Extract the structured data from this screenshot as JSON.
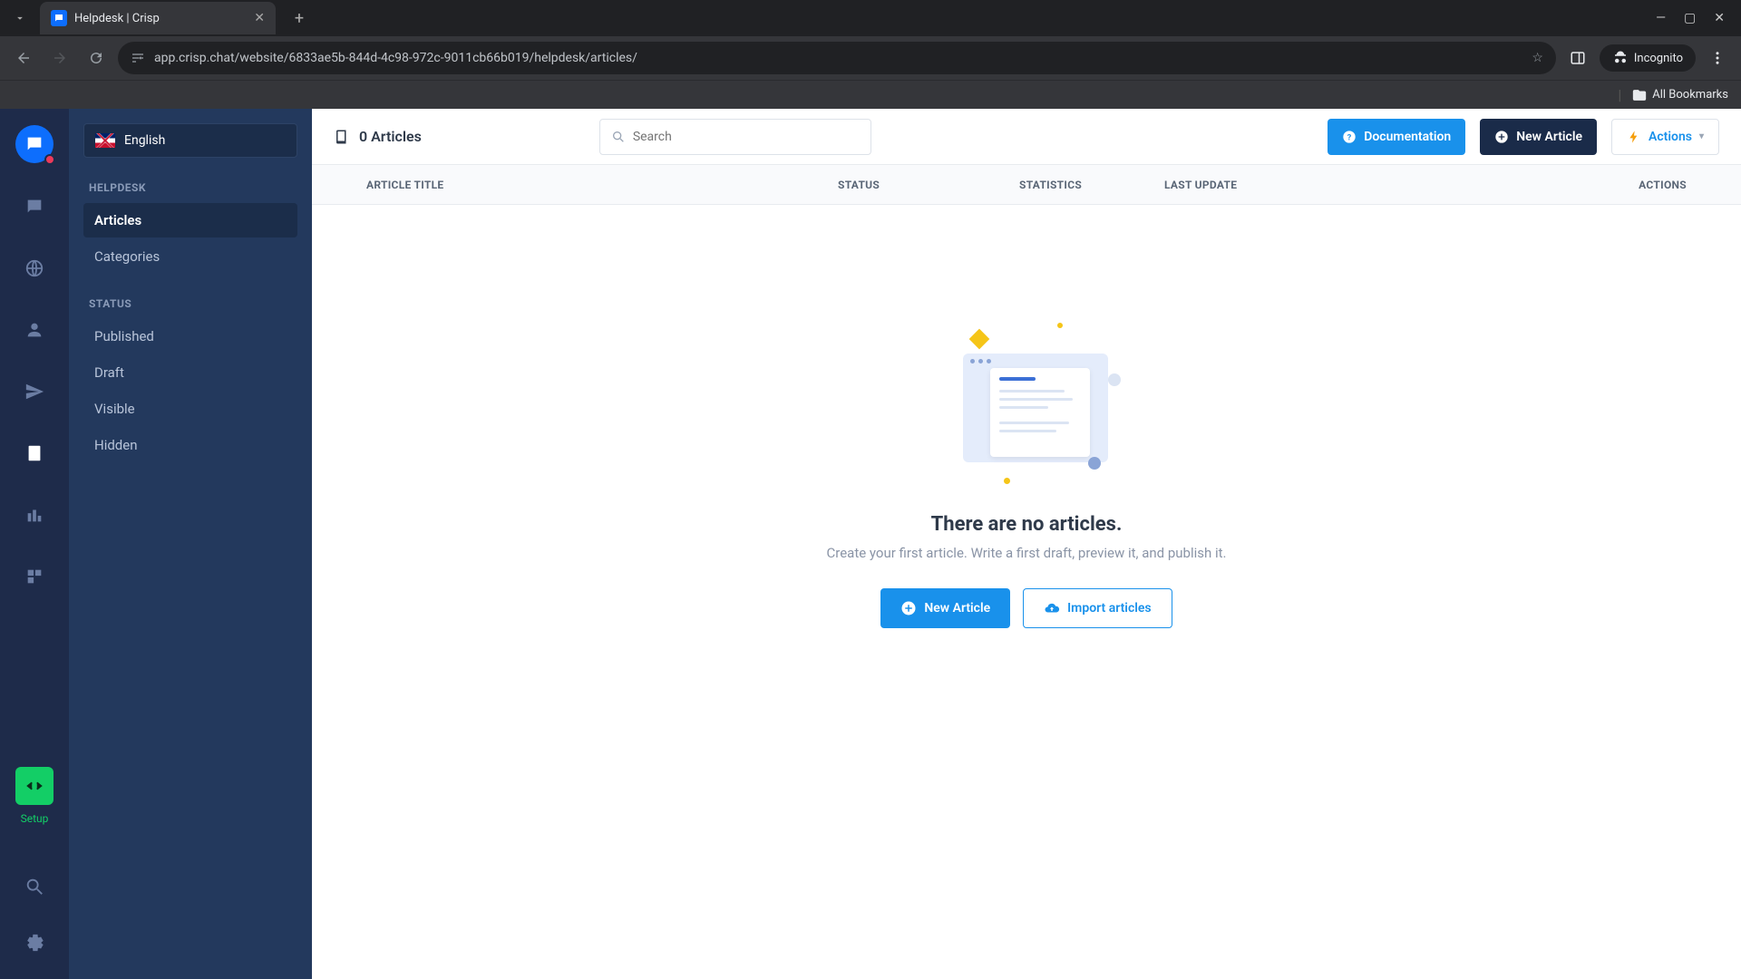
{
  "browser": {
    "tab_title": "Helpdesk | Crisp",
    "url": "app.crisp.chat/website/6833ae5b-844d-4c98-972c-9011cb66b019/helpdesk/articles/",
    "incognito_label": "Incognito",
    "all_bookmarks": "All Bookmarks"
  },
  "rail": {
    "setup_label": "Setup"
  },
  "sidebar": {
    "language": "English",
    "helpdesk_heading": "HELPDESK",
    "articles": "Articles",
    "categories": "Categories",
    "status_heading": "STATUS",
    "published": "Published",
    "draft": "Draft",
    "visible": "Visible",
    "hidden": "Hidden"
  },
  "topbar": {
    "count_label": "0 Articles",
    "search_placeholder": "Search",
    "documentation": "Documentation",
    "new_article": "New Article",
    "actions": "Actions"
  },
  "table": {
    "article_title": "ARTICLE TITLE",
    "status": "STATUS",
    "statistics": "STATISTICS",
    "last_update": "LAST UPDATE",
    "actions": "ACTIONS"
  },
  "empty": {
    "title": "There are no articles.",
    "subtitle": "Create your first article. Write a first draft, preview it, and publish it.",
    "new_article": "New Article",
    "import_articles": "Import articles"
  }
}
